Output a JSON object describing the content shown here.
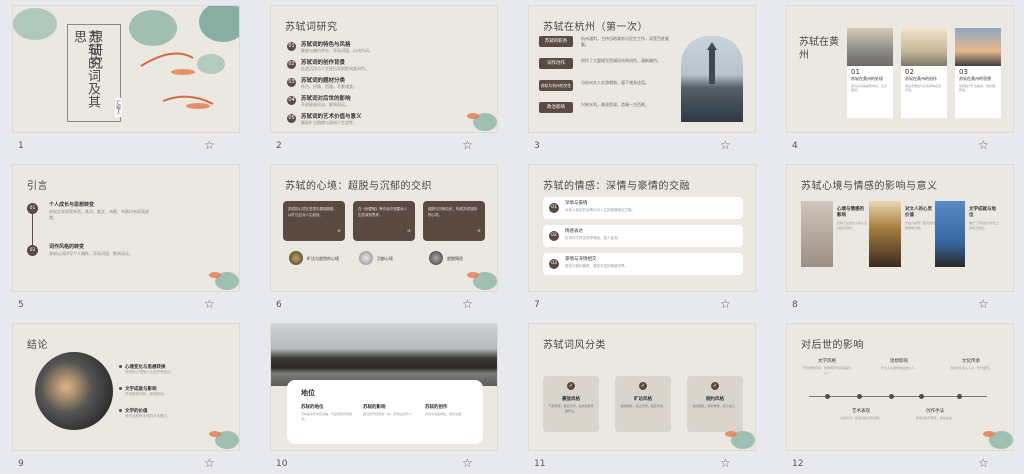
{
  "slides": [
    {
      "number": "1",
      "title_line1": "苏轼的词及其思",
      "title_line2": "想研究",
      "tag": "汇报人"
    },
    {
      "number": "2",
      "title": "苏轼词研究",
      "items": [
        {
          "n": "01",
          "h": "苏轼词的特色与风格",
          "p": "豪放与婉约并存，开拓词境，以诗为词。"
        },
        {
          "n": "02",
          "h": "苏轼词的创作背景",
          "p": "仕途沉浮与人生经历深刻影响其词作。"
        },
        {
          "n": "03",
          "h": "苏轼词的题材分类",
          "p": "怀古、抒情、哲理、写景诸类。"
        },
        {
          "n": "04",
          "h": "苏轼词对后世的影响",
          "p": "开创豪放词派，影响深远。"
        },
        {
          "n": "05",
          "h": "苏轼词的艺术价值与意义",
          "p": "展现旷达胸襟与深刻人生思考。"
        }
      ]
    },
    {
      "number": "3",
      "title": "苏轼在杭州（第一次）",
      "rows": [
        {
          "btn": "苏轼的职务",
          "p": "杭州通判，主持当地政务与民生工作，深受百姓爱戴。"
        },
        {
          "btn": "词作创作",
          "p": "创作了大量描写西湖风光的词作，清新婉约。"
        },
        {
          "btn": "苏轼与杭州的交往",
          "p": "与杭州文人交游唱和，留下诸多佳话。"
        },
        {
          "btn": "政治影响",
          "p": "兴修水利，疏浚西湖，造福一方百姓。"
        }
      ]
    },
    {
      "number": "4",
      "title": "苏轼在黄州",
      "cards": [
        {
          "n": "01",
          "h": "苏轼在黄州的处境",
          "p": "因乌台诗案被贬黄州，生活困顿。"
        },
        {
          "n": "02",
          "h": "苏轼在黄州的创作",
          "p": "前后赤壁赋与念奴娇等名篇问世。"
        },
        {
          "n": "03",
          "h": "苏轼在黄州的思想",
          "p": "思想趋于旷达超然，融合儒释道。"
        }
      ]
    },
    {
      "number": "5",
      "title": "引言",
      "items": [
        {
          "n": "01",
          "h": "个人成长与思想转变",
          "p": "苏轼文学成就卓然，其词、散文、诗歌、书画均有很高成就。"
        },
        {
          "n": "02",
          "h": "词作风格的转变",
          "p": "苏轼以词抒写个人胸怀，开拓词境，影响深远。"
        }
      ]
    },
    {
      "number": "6",
      "title": "苏轼的心境：超脱与沉郁的交织",
      "boxes": [
        {
          "p": "苏轼的心境在逆境中展现超脱，以旷达应对人生起伏。"
        },
        {
          "p": "在《赤壁赋》等作品中流露对人生的深刻思考。"
        },
        {
          "p": "超脱与沉郁交织，构成苏轼独特的心境。"
        }
      ],
      "labels": [
        "旷达与超然的心境",
        "沉郁心境",
        "超脱情思"
      ]
    },
    {
      "number": "7",
      "title": "苏轼的情感：深情与豪情的交融",
      "items": [
        {
          "n": "01",
          "h": "深情与豪情",
          "p": "对亲人朋友的深情与对人生的豪情相互交融。"
        },
        {
          "n": "02",
          "h": "情感表达",
          "p": "在词作中抒发真挚情感，感人至深。"
        },
        {
          "n": "03",
          "h": "豪情与深情相交",
          "p": "豪放与婉约兼具，展现丰富的情感世界。"
        }
      ]
    },
    {
      "number": "8",
      "title": "苏轼心境与情感的影响与意义",
      "items": [
        {
          "h": "心境与情感的影响",
          "p": "影响了后世文人的人生态度与创作。"
        },
        {
          "h": "对文人的心灵价值",
          "p": "为后人提供了面对逆境的精神力量。"
        },
        {
          "h": "文学成就与地位",
          "p": "确立了苏轼在文学史上的崇高地位。"
        }
      ]
    },
    {
      "number": "9",
      "title": "结论",
      "items": [
        {
          "h": "心境变化与思想转换",
          "p": "苏轼的心境随人生经历而变化。"
        },
        {
          "h": "文学成就与影响",
          "p": "开创豪放词风，影响深远。"
        },
        {
          "h": "文学的价值",
          "p": "其作品具有永恒的艺术魅力。"
        }
      ]
    },
    {
      "number": "10",
      "title": "地位",
      "cols": [
        {
          "h": "苏轼的地位",
          "p": "苏轼是北宋文坛领袖，与欧阳修并称欧苏。"
        },
        {
          "h": "苏轼的影响",
          "p": "其词风开创豪放一派，影响后世词人。"
        },
        {
          "h": "苏轼的创作",
          "p": "诗词文书画俱佳，成就全面。"
        }
      ]
    },
    {
      "number": "11",
      "title": "苏轼词风分类",
      "cards": [
        {
          "h": "豪放风格",
          "p": "气势磅礴，意境开阔，如念奴娇赤壁怀古。"
        },
        {
          "h": "旷达风格",
          "p": "超然物外，豁达乐观，如定风波。"
        },
        {
          "h": "婉约风格",
          "p": "情感细腻，缠绵悱恻，如江城子。"
        }
      ]
    },
    {
      "number": "12",
      "title": "对后世的影响",
      "top": [
        {
          "h": "文学风格",
          "p": "开创豪放词风，影响南宋辛弃疾等词人。"
        },
        {
          "h": "思想影响",
          "p": "旷达人生观影响后世文人。"
        },
        {
          "h": "文化传承",
          "p": "苏轼文化深入人心，代代相传。"
        }
      ],
      "bottom": [
        {
          "h": "艺术表现",
          "p": "以诗为词，拓宽词的表现领域。"
        },
        {
          "h": "创作手法",
          "p": "善用比喻与夸张，语言生动。"
        }
      ]
    }
  ],
  "star_icon": "☆",
  "colors": {
    "accent": "#5a4a42",
    "slide_bg": "#ebe7e1",
    "page_bg": "#e8e9ee"
  }
}
